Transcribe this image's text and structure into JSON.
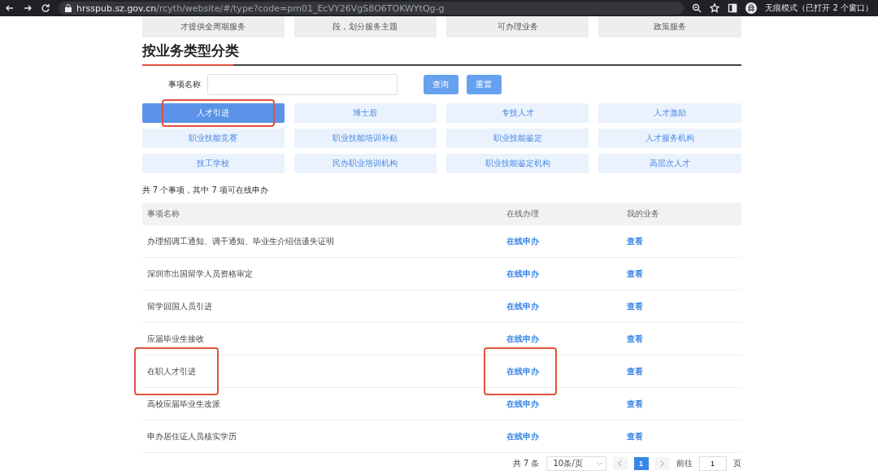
{
  "browser": {
    "url_host": "hrsspub.sz.gov.cn",
    "url_path": "/rcyth/website/#/type?code=pm01_EcVY26VgS8O6TOKWYtQg-g",
    "profile": "无痕模式（已打开 2 个窗口）"
  },
  "top_cards": [
    "才提供全周期服务",
    "段，划分服务主题",
    "可办理业务",
    "政策服务"
  ],
  "section_title": "按业务类型分类",
  "search": {
    "label": "事项名称",
    "query_button": "查询",
    "reset_button": "重置"
  },
  "categories": [
    {
      "label": "人才引进",
      "selected": true,
      "highlighted": true
    },
    {
      "label": "博士后",
      "selected": false,
      "highlighted": false
    },
    {
      "label": "专技人才",
      "selected": false,
      "highlighted": false
    },
    {
      "label": "人才激励",
      "selected": false,
      "highlighted": false
    },
    {
      "label": "职业技能竞赛",
      "selected": false,
      "highlighted": false
    },
    {
      "label": "职业技能培训补贴",
      "selected": false,
      "highlighted": false
    },
    {
      "label": "职业技能鉴定",
      "selected": false,
      "highlighted": false
    },
    {
      "label": "人才服务机构",
      "selected": false,
      "highlighted": false
    },
    {
      "label": "技工学校",
      "selected": false,
      "highlighted": false
    },
    {
      "label": "民办职业培训机构",
      "selected": false,
      "highlighted": false
    },
    {
      "label": "职业技能鉴定机构",
      "selected": false,
      "highlighted": false
    },
    {
      "label": "高层次人才",
      "selected": false,
      "highlighted": false
    }
  ],
  "summary": "共 7 个事项，其中 7 项可在线申办",
  "table": {
    "columns": [
      "事项名称",
      "在线办理",
      "我的业务"
    ],
    "rows": [
      {
        "name": "办理招调工通知、调干通知、毕业生介绍信遗失证明",
        "apply": "在线申办",
        "view": "查看",
        "highlighted": false
      },
      {
        "name": "深圳市出国留学人员资格审定",
        "apply": "在线申办",
        "view": "查看",
        "highlighted": false
      },
      {
        "name": "留学回国人员引进",
        "apply": "在线申办",
        "view": "查看",
        "highlighted": false
      },
      {
        "name": "应届毕业生接收",
        "apply": "在线申办",
        "view": "查看",
        "highlighted": false
      },
      {
        "name": "在职人才引进",
        "apply": "在线申办",
        "view": "查看",
        "highlighted": true
      },
      {
        "name": "高校应届毕业生改派",
        "apply": "在线申办",
        "view": "查看",
        "highlighted": false
      },
      {
        "name": "申办居住证人员核实学历",
        "apply": "在线申办",
        "view": "查看",
        "highlighted": false
      }
    ]
  },
  "pagination": {
    "total": "共 7 条",
    "page_size": "10条/页",
    "pages": [
      {
        "label": "1",
        "selected": true
      }
    ],
    "goto_label": "前往",
    "goto_value": "1",
    "page_unit": "页"
  }
}
